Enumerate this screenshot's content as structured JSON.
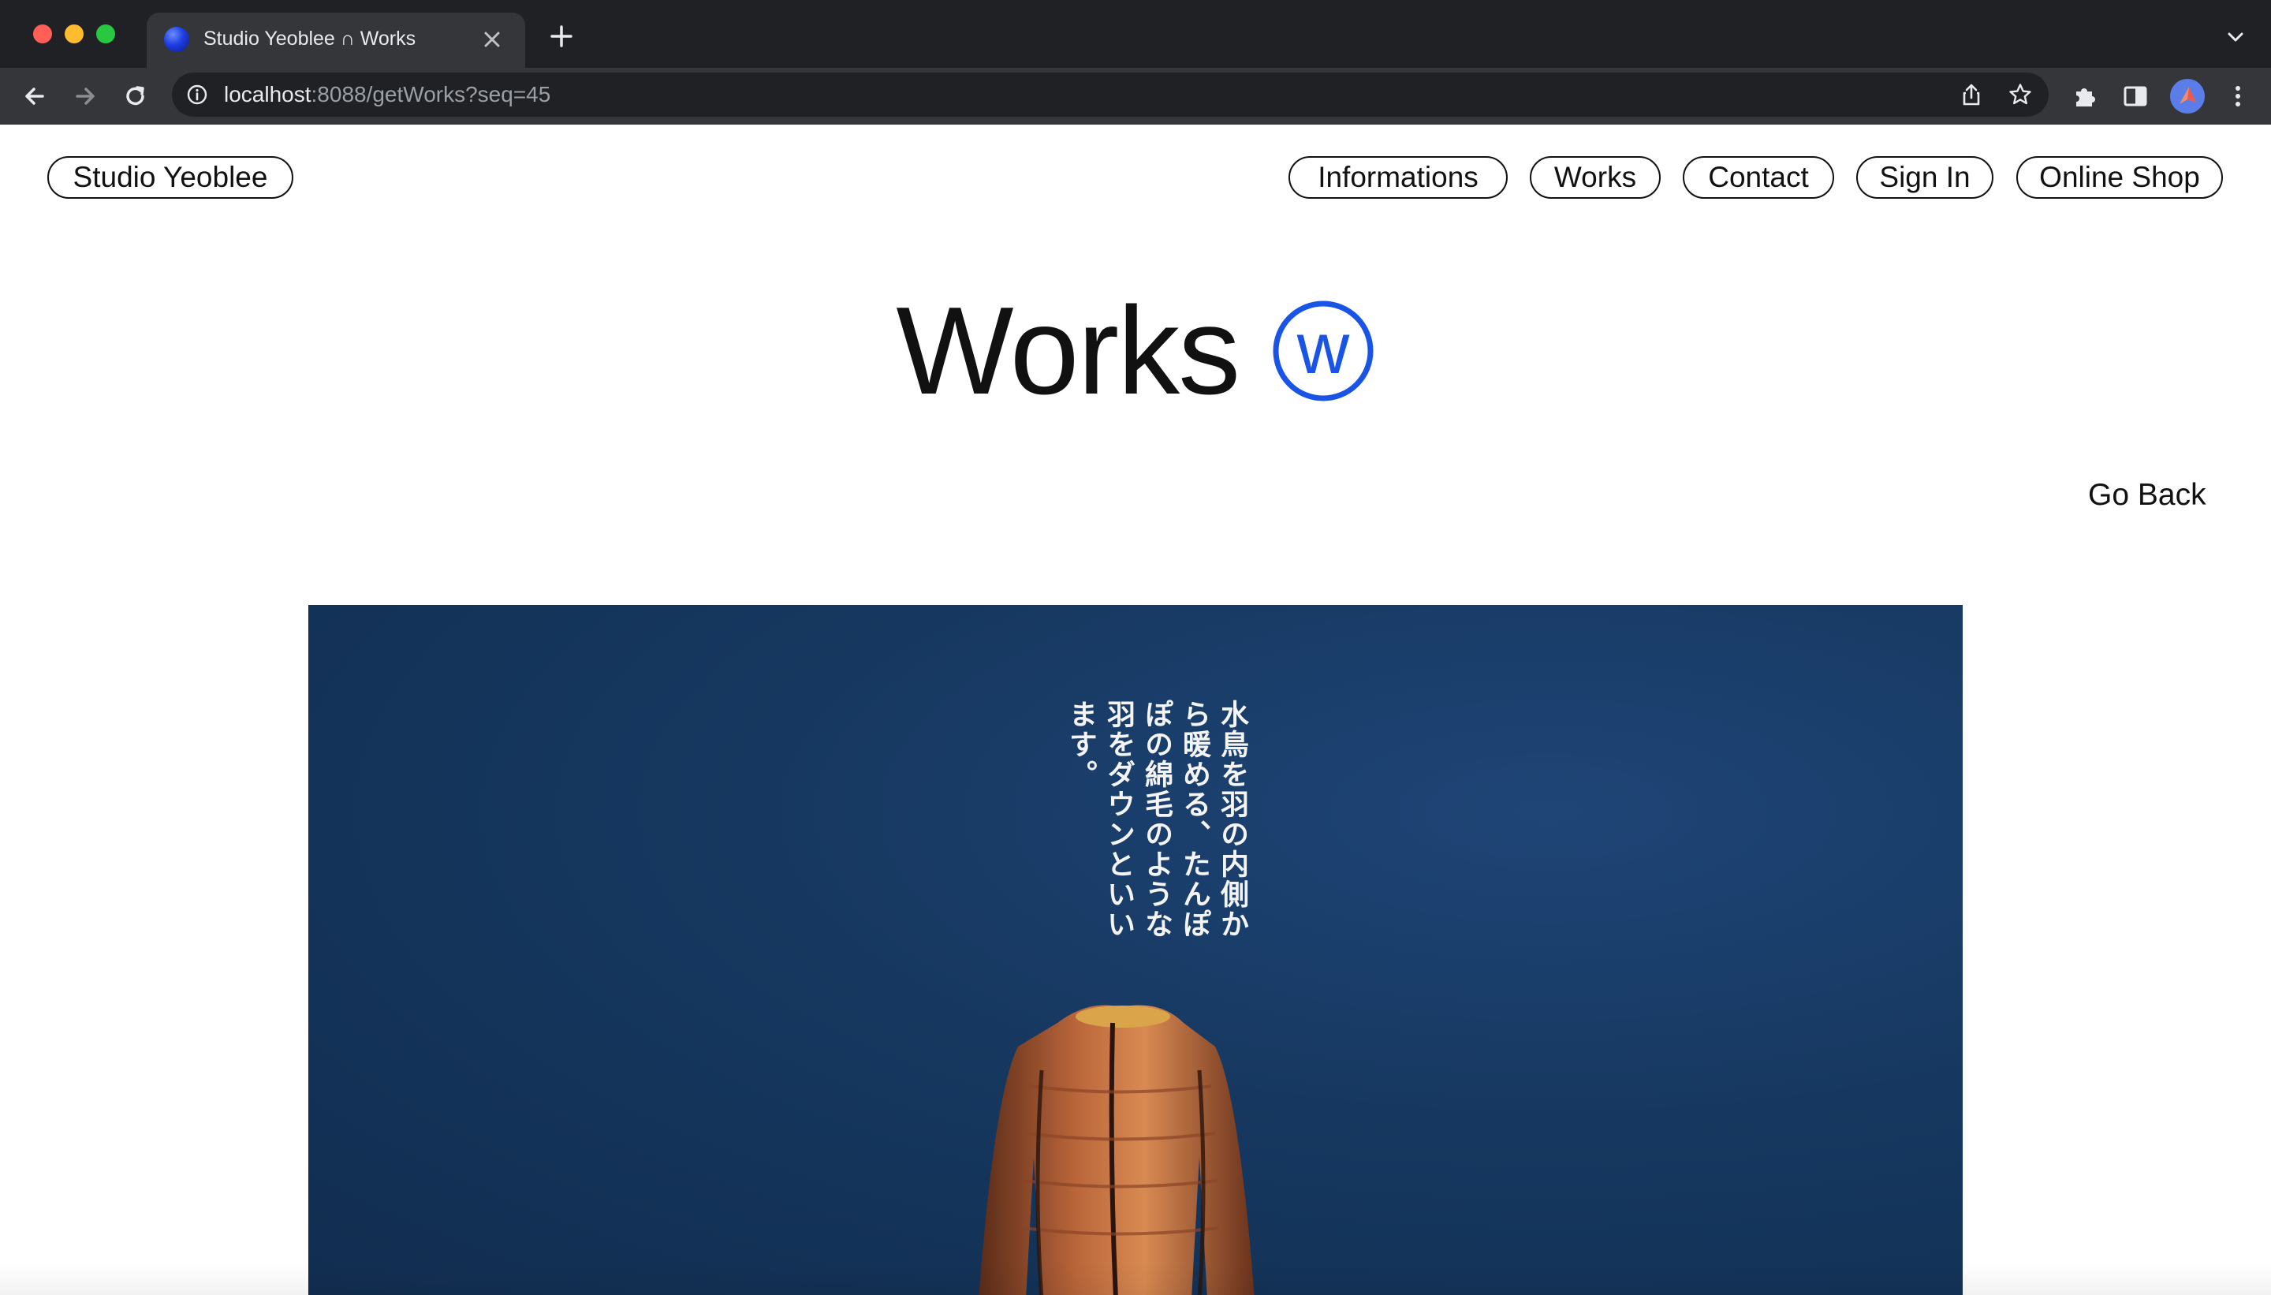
{
  "browser": {
    "tab_title": "Studio Yeoblee ∩ Works",
    "url_host": "localhost",
    "url_path": ":8088/getWorks?seq=45",
    "icons": [
      "back-icon",
      "forward-icon",
      "reload-icon",
      "site-info-icon",
      "share-icon",
      "bookmark-star-icon",
      "extensions-icon",
      "side-panel-icon",
      "profile-avatar",
      "more-menu-icon"
    ],
    "colors": {
      "chrome_dark": "#1f2124",
      "toolbar": "#35363a",
      "omnibox": "#202124"
    }
  },
  "header": {
    "brand_label": "Studio Yeoblee",
    "nav": {
      "informations": "Informations",
      "works": "Works",
      "contact": "Contact",
      "sign_in": "Sign In",
      "online_shop": "Online Shop"
    }
  },
  "main": {
    "title": "Works",
    "title_mark": "w",
    "go_back": "Go Back",
    "hero_copy": "水鳥を羽の内側から暖める、たんぽぽの綿毛のような羽をダウンといいます。",
    "colors": {
      "accent_mark": "#1a54e6",
      "hero_bg": "#163860",
      "text": "#111111"
    }
  }
}
